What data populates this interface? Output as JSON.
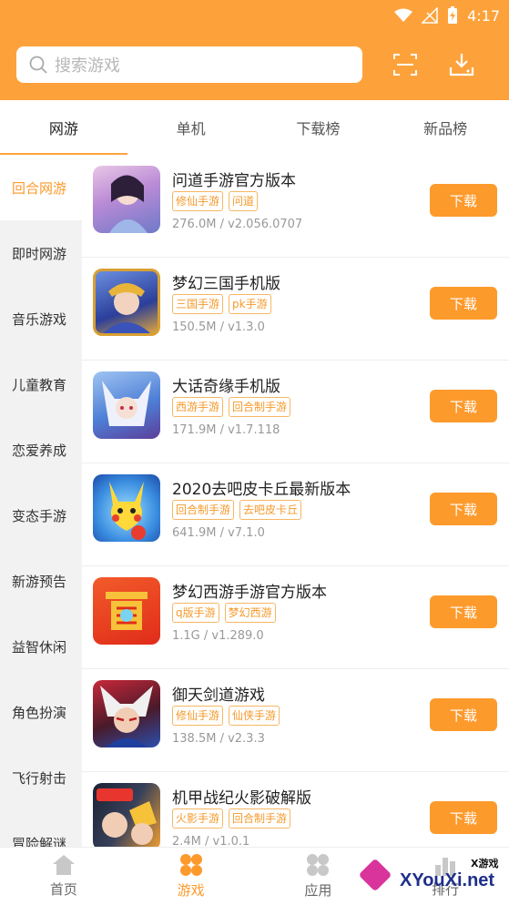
{
  "status_bar": {
    "time": "4:17"
  },
  "search": {
    "placeholder": "搜索游戏"
  },
  "tabs": [
    {
      "label": "网游",
      "active": true
    },
    {
      "label": "单机",
      "active": false
    },
    {
      "label": "下载榜",
      "active": false
    },
    {
      "label": "新品榜",
      "active": false
    }
  ],
  "sidebar": {
    "items": [
      {
        "label": "回合网游",
        "active": true
      },
      {
        "label": "即时网游"
      },
      {
        "label": "音乐游戏"
      },
      {
        "label": "儿童教育"
      },
      {
        "label": "恋爱养成"
      },
      {
        "label": "变态手游"
      },
      {
        "label": "新游预告"
      },
      {
        "label": "益智休闲"
      },
      {
        "label": "角色扮演"
      },
      {
        "label": "飞行射击"
      },
      {
        "label": "冒险解谜"
      }
    ]
  },
  "games": [
    {
      "name": "问道手游官方版本",
      "tags": [
        "修仙手游",
        "问道"
      ],
      "meta": "276.0M / v2.056.0707",
      "button": "下载"
    },
    {
      "name": "梦幻三国手机版",
      "tags": [
        "三国手游",
        "pk手游"
      ],
      "meta": "150.5M / v1.3.0",
      "button": "下载"
    },
    {
      "name": "大话奇缘手机版",
      "tags": [
        "西游手游",
        "回合制手游"
      ],
      "meta": "171.9M / v1.7.118",
      "button": "下载"
    },
    {
      "name": "2020去吧皮卡丘最新版本",
      "tags": [
        "回合制手游",
        "去吧皮卡丘"
      ],
      "meta": "641.9M / v7.1.0",
      "button": "下载"
    },
    {
      "name": "梦幻西游手游官方版本",
      "tags": [
        "q版手游",
        "梦幻西游"
      ],
      "meta": "1.1G / v1.289.0",
      "button": "下载"
    },
    {
      "name": "御天剑道游戏",
      "tags": [
        "修仙手游",
        "仙侠手游"
      ],
      "meta": "138.5M / v2.3.3",
      "button": "下载"
    },
    {
      "name": "机甲战纪火影破解版",
      "tags": [
        "火影手游",
        "回合制手游"
      ],
      "meta": "2.4M / v1.0.1",
      "button": "下载"
    }
  ],
  "bottom_nav": [
    {
      "label": "首页",
      "icon": "home-icon"
    },
    {
      "label": "游戏",
      "icon": "game-grid-icon",
      "active": true
    },
    {
      "label": "应用",
      "icon": "apps-icon"
    },
    {
      "label": "排行",
      "icon": "rank-icon"
    }
  ],
  "watermark": {
    "text": "XYouXi.net",
    "sub": "X游戏"
  },
  "colors": {
    "accent": "#fd9a2c",
    "header": "#fda23b"
  }
}
